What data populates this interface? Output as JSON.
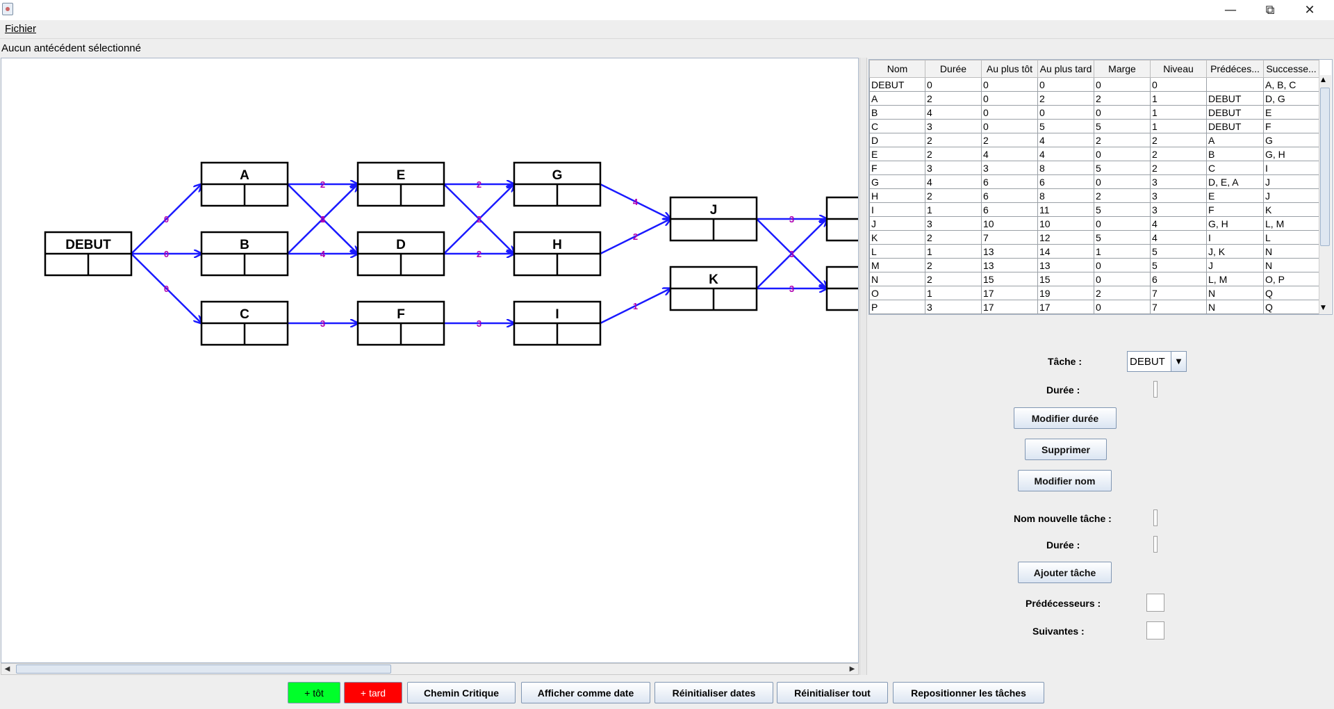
{
  "menu": {
    "fichier": "Fichier"
  },
  "status_text": "Aucun antécédent sélectionné",
  "graph": {
    "nodes": [
      {
        "name": "DEBUT",
        "col": 0,
        "row": 1
      },
      {
        "name": "A",
        "col": 1,
        "row": 0
      },
      {
        "name": "B",
        "col": 1,
        "row": 1
      },
      {
        "name": "C",
        "col": 1,
        "row": 2
      },
      {
        "name": "E",
        "col": 2,
        "row": 0
      },
      {
        "name": "D",
        "col": 2,
        "row": 1
      },
      {
        "name": "F",
        "col": 2,
        "row": 2
      },
      {
        "name": "G",
        "col": 3,
        "row": 0
      },
      {
        "name": "H",
        "col": 3,
        "row": 1
      },
      {
        "name": "I",
        "col": 3,
        "row": 2
      },
      {
        "name": "J",
        "col": 4,
        "row": 0.5
      },
      {
        "name": "K",
        "col": 4,
        "row": 1.5
      },
      {
        "name": "",
        "col": 5,
        "row": 0.5
      },
      {
        "name": "",
        "col": 5,
        "row": 1.5
      }
    ],
    "edges": [
      {
        "from": "DEBUT",
        "to": "A",
        "label": "0"
      },
      {
        "from": "DEBUT",
        "to": "B",
        "label": "0"
      },
      {
        "from": "DEBUT",
        "to": "C",
        "label": "0"
      },
      {
        "from": "A",
        "to": "E",
        "label": "2"
      },
      {
        "from": "A",
        "to": "D",
        "label": "2"
      },
      {
        "from": "B",
        "to": "E",
        "label": "4"
      },
      {
        "from": "B",
        "to": "D",
        "label": "4"
      },
      {
        "from": "C",
        "to": "F",
        "label": "3"
      },
      {
        "from": "E",
        "to": "G",
        "label": "2"
      },
      {
        "from": "E",
        "to": "H",
        "label": "2"
      },
      {
        "from": "D",
        "to": "G",
        "label": "2"
      },
      {
        "from": "D",
        "to": "H",
        "label": "2"
      },
      {
        "from": "F",
        "to": "I",
        "label": "3"
      },
      {
        "from": "G",
        "to": "J",
        "label": "4"
      },
      {
        "from": "H",
        "to": "J",
        "label": "2"
      },
      {
        "from": "I",
        "to": "K",
        "label": "1"
      },
      {
        "from": "J",
        "to": "N1",
        "label": "3"
      },
      {
        "from": "J",
        "to": "N2",
        "label": "3"
      },
      {
        "from": "K",
        "to": "N1",
        "label": "3"
      },
      {
        "from": "K",
        "to": "N2",
        "label": "3"
      }
    ],
    "colors": {
      "edge": "#1a1aff",
      "label": "#b000b0",
      "node_border": "#000000"
    }
  },
  "table": {
    "headers": [
      "Nom",
      "Durée",
      "Au plus tôt",
      "Au plus tard",
      "Marge",
      "Niveau",
      "Prédéces...",
      "Successe..."
    ],
    "rows": [
      [
        "DEBUT",
        "0",
        "0",
        "0",
        "0",
        "0",
        "",
        "A, B, C"
      ],
      [
        "A",
        "2",
        "0",
        "2",
        "2",
        "1",
        "DEBUT",
        "D, G"
      ],
      [
        "B",
        "4",
        "0",
        "0",
        "0",
        "1",
        "DEBUT",
        "E"
      ],
      [
        "C",
        "3",
        "0",
        "5",
        "5",
        "1",
        "DEBUT",
        "F"
      ],
      [
        "D",
        "2",
        "2",
        "4",
        "2",
        "2",
        "A",
        "G"
      ],
      [
        "E",
        "2",
        "4",
        "4",
        "0",
        "2",
        "B",
        "G, H"
      ],
      [
        "F",
        "3",
        "3",
        "8",
        "5",
        "2",
        "C",
        "I"
      ],
      [
        "G",
        "4",
        "6",
        "6",
        "0",
        "3",
        "D, E, A",
        "J"
      ],
      [
        "H",
        "2",
        "6",
        "8",
        "2",
        "3",
        "E",
        "J"
      ],
      [
        "I",
        "1",
        "6",
        "11",
        "5",
        "3",
        "F",
        "K"
      ],
      [
        "J",
        "3",
        "10",
        "10",
        "0",
        "4",
        "G, H",
        "L, M"
      ],
      [
        "K",
        "2",
        "7",
        "12",
        "5",
        "4",
        "I",
        "L"
      ],
      [
        "L",
        "1",
        "13",
        "14",
        "1",
        "5",
        "J, K",
        "N"
      ],
      [
        "M",
        "2",
        "13",
        "13",
        "0",
        "5",
        "J",
        "N"
      ],
      [
        "N",
        "2",
        "15",
        "15",
        "0",
        "6",
        "L, M",
        "O, P"
      ],
      [
        "O",
        "1",
        "17",
        "19",
        "2",
        "7",
        "N",
        "Q"
      ],
      [
        "P",
        "3",
        "17",
        "17",
        "0",
        "7",
        "N",
        "Q"
      ]
    ]
  },
  "form": {
    "tache_label": "Tâche :",
    "tache_value": "DEBUT",
    "duree_label": "Durée :",
    "modifier_duree": "Modifier durée",
    "supprimer": "Supprimer",
    "modifier_nom": "Modifier nom",
    "nom_nouvelle_label": "Nom nouvelle tâche :",
    "duree2_label": "Durée :",
    "ajouter": "Ajouter tâche",
    "predecesseurs_label": "Prédécesseurs :",
    "suivantes_label": "Suivantes :"
  },
  "bottom_buttons": {
    "tot": "+ tôt",
    "tard": "+ tard",
    "chemin": "Chemin Critique",
    "afficher": "Afficher comme date",
    "reinit_dates": "Réinitialiser dates",
    "reinit_tout": "Réinitialiser tout",
    "repositionner": "Repositionner les tâches"
  },
  "button_colors": {
    "tot": "#00ff2a",
    "tard": "#ff0000"
  }
}
